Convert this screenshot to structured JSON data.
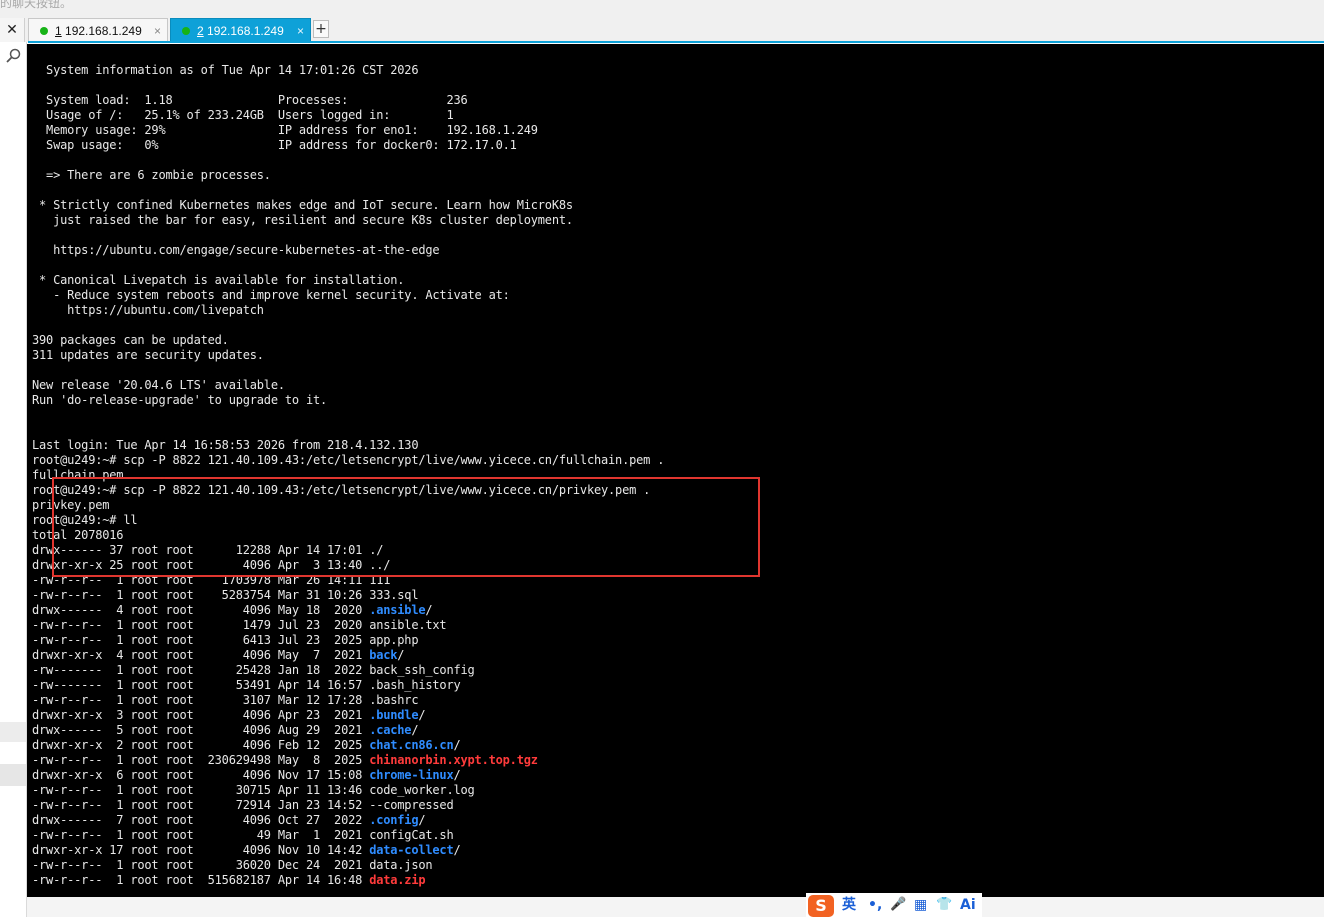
{
  "top_hint": "的聊天按钮。",
  "tabs": [
    {
      "num": "1",
      "label": "192.168.1.249",
      "active": false
    },
    {
      "num": "2",
      "label": "192.168.1.249",
      "active": true
    }
  ],
  "tab_close_glyph": "×",
  "add_tab_glyph": "+",
  "close_glyph": "✕",
  "colors": {
    "terminal_bg": "#000000",
    "terminal_fg": "#e8e8e8",
    "dir": "#2f8cff",
    "archive": "#ff3b3b",
    "accent": "#0ea1d8",
    "highlight": "#e0362f",
    "tab_dot": "#17b317"
  },
  "terminal_lines": [
    {
      "text": "  System information as of Tue Apr 14 17:01:26 CST 2026"
    },
    {
      "text": ""
    },
    {
      "text": "  System load:  1.18               Processes:              236"
    },
    {
      "text": "  Usage of /:   25.1% of 233.24GB  Users logged in:        1"
    },
    {
      "text": "  Memory usage: 29%                IP address for eno1:    192.168.1.249"
    },
    {
      "text": "  Swap usage:   0%                 IP address for docker0: 172.17.0.1"
    },
    {
      "text": ""
    },
    {
      "text": "  => There are 6 zombie processes."
    },
    {
      "text": ""
    },
    {
      "text": " * Strictly confined Kubernetes makes edge and IoT secure. Learn how MicroK8s"
    },
    {
      "text": "   just raised the bar for easy, resilient and secure K8s cluster deployment."
    },
    {
      "text": ""
    },
    {
      "text": "   https://ubuntu.com/engage/secure-kubernetes-at-the-edge"
    },
    {
      "text": ""
    },
    {
      "text": " * Canonical Livepatch is available for installation."
    },
    {
      "text": "   - Reduce system reboots and improve kernel security. Activate at:"
    },
    {
      "text": "     https://ubuntu.com/livepatch"
    },
    {
      "text": ""
    },
    {
      "text": "390 packages can be updated."
    },
    {
      "text": "311 updates are security updates."
    },
    {
      "text": ""
    },
    {
      "text": "New release '20.04.6 LTS' available."
    },
    {
      "text": "Run 'do-release-upgrade' to upgrade to it."
    },
    {
      "text": ""
    },
    {
      "text": ""
    },
    {
      "text": "Last login: Tue Apr 14 16:58:53 2026 from 218.4.132.130"
    },
    {
      "text": "root@u249:~# scp -P 8822 121.40.109.43:/etc/letsencrypt/live/www.yicece.cn/fullchain.pem ."
    },
    {
      "text": "fullchain.pem"
    },
    {
      "text": "root@u249:~# scp -P 8822 121.40.109.43:/etc/letsencrypt/live/www.yicece.cn/privkey.pem ."
    },
    {
      "text": "privkey.pem"
    },
    {
      "text": "root@u249:~# ll"
    },
    {
      "text": "total 2078016"
    },
    {
      "text": "drwx------ 37 root root      12288 Apr 14 17:01 ",
      "name": "./",
      "kind": "plain"
    },
    {
      "text": "drwxr-xr-x 25 root root       4096 Apr  3 13:40 ",
      "name": "../",
      "kind": "plain"
    },
    {
      "text": "-rw-r--r--  1 root root    1703978 Mar 26 14:11 ",
      "name": "111",
      "kind": "plain"
    },
    {
      "text": "-rw-r--r--  1 root root    5283754 Mar 31 10:26 ",
      "name": "333.sql",
      "kind": "plain"
    },
    {
      "text": "drwx------  4 root root       4096 May 18  2020 ",
      "name": ".ansible",
      "kind": "dir"
    },
    {
      "text": "-rw-r--r--  1 root root       1479 Jul 23  2020 ",
      "name": "ansible.txt",
      "kind": "plain"
    },
    {
      "text": "-rw-r--r--  1 root root       6413 Jul 23  2025 ",
      "name": "app.php",
      "kind": "plain"
    },
    {
      "text": "drwxr-xr-x  4 root root       4096 May  7  2021 ",
      "name": "back",
      "kind": "dir"
    },
    {
      "text": "-rw-------  1 root root      25428 Jan 18  2022 ",
      "name": "back_ssh_config",
      "kind": "plain"
    },
    {
      "text": "-rw-------  1 root root      53491 Apr 14 16:57 ",
      "name": ".bash_history",
      "kind": "plain"
    },
    {
      "text": "-rw-r--r--  1 root root       3107 Mar 12 17:28 ",
      "name": ".bashrc",
      "kind": "plain"
    },
    {
      "text": "drwxr-xr-x  3 root root       4096 Apr 23  2021 ",
      "name": ".bundle",
      "kind": "dir"
    },
    {
      "text": "drwx------  5 root root       4096 Aug 29  2021 ",
      "name": ".cache",
      "kind": "dir"
    },
    {
      "text": "drwxr-xr-x  2 root root       4096 Feb 12  2025 ",
      "name": "chat.cn86.cn",
      "kind": "dir"
    },
    {
      "text": "-rw-r--r--  1 root root  230629498 May  8  2025 ",
      "name": "chinanorbin.xypt.top.tgz",
      "kind": "archive"
    },
    {
      "text": "drwxr-xr-x  6 root root       4096 Nov 17 15:08 ",
      "name": "chrome-linux",
      "kind": "dir"
    },
    {
      "text": "-rw-r--r--  1 root root      30715 Apr 11 13:46 ",
      "name": "code_worker.log",
      "kind": "plain"
    },
    {
      "text": "-rw-r--r--  1 root root      72914 Jan 23 14:52 ",
      "name": "--compressed",
      "kind": "plain"
    },
    {
      "text": "drwx------  7 root root       4096 Oct 27  2022 ",
      "name": ".config",
      "kind": "dir"
    },
    {
      "text": "-rw-r--r--  1 root root         49 Mar  1  2021 ",
      "name": "configCat.sh",
      "kind": "plain"
    },
    {
      "text": "drwxr-xr-x 17 root root       4096 Nov 10 14:42 ",
      "name": "data-collect",
      "kind": "dir"
    },
    {
      "text": "-rw-r--r--  1 root root      36020 Dec 24  2021 ",
      "name": "data.json",
      "kind": "plain"
    },
    {
      "text": "-rw-r--r--  1 root root  515682187 Apr 14 16:48 ",
      "name": "data.zip",
      "kind": "archive"
    }
  ],
  "ime": {
    "logo": "S",
    "lang": "英",
    "punct": "•,",
    "mic": "🎤",
    "kbd": "▦",
    "shirt": "👕",
    "ai": "Ai"
  }
}
